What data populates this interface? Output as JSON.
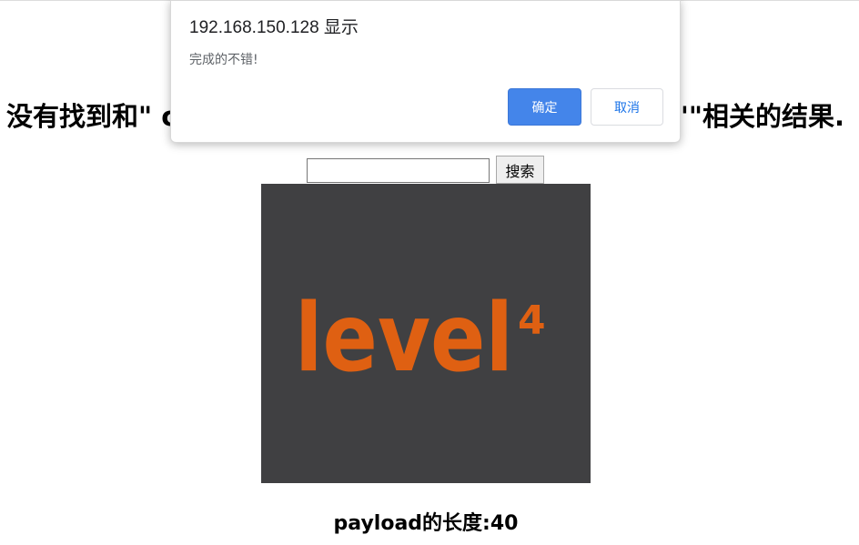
{
  "page": {
    "heading_left": "没有找到和\" c",
    "heading_right": "\"\"相关的结果.",
    "payload_length": "payload的长度:40"
  },
  "search": {
    "value": "",
    "button_label": "搜索"
  },
  "image": {
    "logo_text": "level",
    "logo_superscript": "4",
    "background": "#404042",
    "accent": "#df6012"
  },
  "alert": {
    "origin": "192.168.150.128 显示",
    "message": "完成的不错!",
    "ok_label": "确定",
    "cancel_label": "取消",
    "ok_color": "#4485ea"
  }
}
